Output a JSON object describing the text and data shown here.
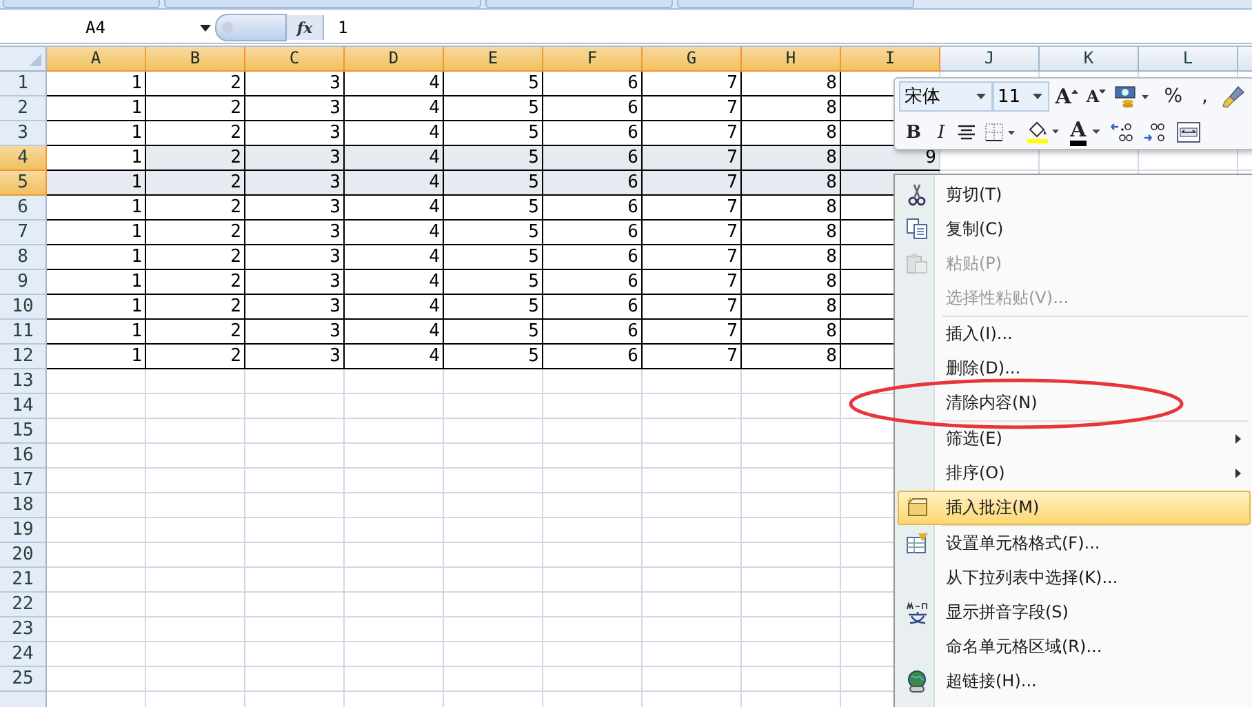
{
  "formula_bar": {
    "name_box": "A4",
    "function_label": "fx",
    "formula": "1"
  },
  "columns": [
    {
      "label": "A",
      "selected": true
    },
    {
      "label": "B",
      "selected": true
    },
    {
      "label": "C",
      "selected": true
    },
    {
      "label": "D",
      "selected": true
    },
    {
      "label": "E",
      "selected": true
    },
    {
      "label": "F",
      "selected": true
    },
    {
      "label": "G",
      "selected": true
    },
    {
      "label": "H",
      "selected": true
    },
    {
      "label": "I",
      "selected": true
    },
    {
      "label": "J",
      "selected": false
    },
    {
      "label": "K",
      "selected": false
    },
    {
      "label": "L",
      "selected": false
    }
  ],
  "rows": [
    {
      "label": "1",
      "selected": false,
      "cells": [
        "1",
        "2",
        "3",
        "4",
        "5",
        "6",
        "7",
        "8"
      ]
    },
    {
      "label": "2",
      "selected": false,
      "cells": [
        "1",
        "2",
        "3",
        "4",
        "5",
        "6",
        "7",
        "8"
      ]
    },
    {
      "label": "3",
      "selected": false,
      "cells": [
        "1",
        "2",
        "3",
        "4",
        "5",
        "6",
        "7",
        "8"
      ]
    },
    {
      "label": "4",
      "selected": true,
      "active": true,
      "cells": [
        "1",
        "2",
        "3",
        "4",
        "5",
        "6",
        "7",
        "8",
        "9"
      ]
    },
    {
      "label": "5",
      "selected": true,
      "cells": [
        "1",
        "2",
        "3",
        "4",
        "5",
        "6",
        "7",
        "8"
      ]
    },
    {
      "label": "6",
      "selected": false,
      "cells": [
        "1",
        "2",
        "3",
        "4",
        "5",
        "6",
        "7",
        "8"
      ]
    },
    {
      "label": "7",
      "selected": false,
      "cells": [
        "1",
        "2",
        "3",
        "4",
        "5",
        "6",
        "7",
        "8"
      ]
    },
    {
      "label": "8",
      "selected": false,
      "cells": [
        "1",
        "2",
        "3",
        "4",
        "5",
        "6",
        "7",
        "8"
      ]
    },
    {
      "label": "9",
      "selected": false,
      "cells": [
        "1",
        "2",
        "3",
        "4",
        "5",
        "6",
        "7",
        "8"
      ]
    },
    {
      "label": "10",
      "selected": false,
      "cells": [
        "1",
        "2",
        "3",
        "4",
        "5",
        "6",
        "7",
        "8"
      ]
    },
    {
      "label": "11",
      "selected": false,
      "cells": [
        "1",
        "2",
        "3",
        "4",
        "5",
        "6",
        "7",
        "8"
      ]
    },
    {
      "label": "12",
      "selected": false,
      "cells": [
        "1",
        "2",
        "3",
        "4",
        "5",
        "6",
        "7",
        "8"
      ]
    },
    {
      "label": "13",
      "selected": false
    },
    {
      "label": "14",
      "selected": false
    },
    {
      "label": "15",
      "selected": false
    },
    {
      "label": "16",
      "selected": false
    },
    {
      "label": "17",
      "selected": false
    },
    {
      "label": "18",
      "selected": false
    },
    {
      "label": "19",
      "selected": false
    },
    {
      "label": "20",
      "selected": false
    },
    {
      "label": "21",
      "selected": false
    },
    {
      "label": "22",
      "selected": false
    },
    {
      "label": "23",
      "selected": false
    },
    {
      "label": "24",
      "selected": false
    },
    {
      "label": "25",
      "selected": false
    }
  ],
  "mini_toolbar": {
    "font": "宋体",
    "size": "11",
    "row_1": [
      {
        "kind": "grow",
        "label": "A"
      },
      {
        "kind": "shrink",
        "label": "A"
      },
      {
        "kind": "accounting"
      },
      {
        "kind": "char",
        "label": "%"
      },
      {
        "kind": "char",
        "label": ","
      },
      {
        "kind": "painter"
      }
    ],
    "row_2": [
      {
        "kind": "bold",
        "label": "B"
      },
      {
        "kind": "italic",
        "label": "I"
      },
      {
        "kind": "center"
      },
      {
        "kind": "border"
      },
      {
        "kind": "fill"
      },
      {
        "kind": "fontcolor",
        "label": "A"
      },
      {
        "kind": "incdec"
      },
      {
        "kind": "decdec"
      },
      {
        "kind": "merge"
      }
    ]
  },
  "context_menu": [
    {
      "label": "剪切(T)",
      "kind": "cut",
      "disabled": false,
      "selected": false
    },
    {
      "label": "复制(C)",
      "kind": "copy",
      "disabled": false,
      "selected": false
    },
    {
      "label": "粘贴(P)",
      "kind": "paste",
      "disabled": true,
      "selected": false
    },
    {
      "label": "选择性粘贴(V)...",
      "kind": "plain",
      "disabled": true,
      "selected": false
    },
    {
      "label": "插入(I)...",
      "kind": "plain",
      "disabled": false,
      "selected": false,
      "separator_before": true
    },
    {
      "label": "删除(D)...",
      "kind": "plain",
      "disabled": false,
      "selected": false
    },
    {
      "label": "清除内容(N)",
      "kind": "plain",
      "disabled": false,
      "selected": false
    },
    {
      "label": "筛选(E)",
      "kind": "plain",
      "disabled": false,
      "selected": false,
      "separator_before": true,
      "submenu": true
    },
    {
      "label": "排序(O)",
      "kind": "plain",
      "disabled": false,
      "selected": false,
      "submenu": true
    },
    {
      "label": "插入批注(M)",
      "kind": "comment",
      "disabled": false,
      "selected": true
    },
    {
      "label": "设置单元格格式(F)...",
      "kind": "format",
      "disabled": false,
      "selected": false,
      "separator_before": true
    },
    {
      "label": "从下拉列表中选择(K)...",
      "kind": "plain",
      "disabled": false,
      "selected": false
    },
    {
      "label": "显示拼音字段(S)",
      "kind": "phonetic",
      "disabled": false,
      "selected": false
    },
    {
      "label": "命名单元格区域(R)...",
      "kind": "plain",
      "disabled": false,
      "selected": false
    },
    {
      "label": "超链接(H)...",
      "kind": "link",
      "disabled": false,
      "selected": false
    }
  ],
  "annotation": {
    "kind": "ellipse"
  }
}
